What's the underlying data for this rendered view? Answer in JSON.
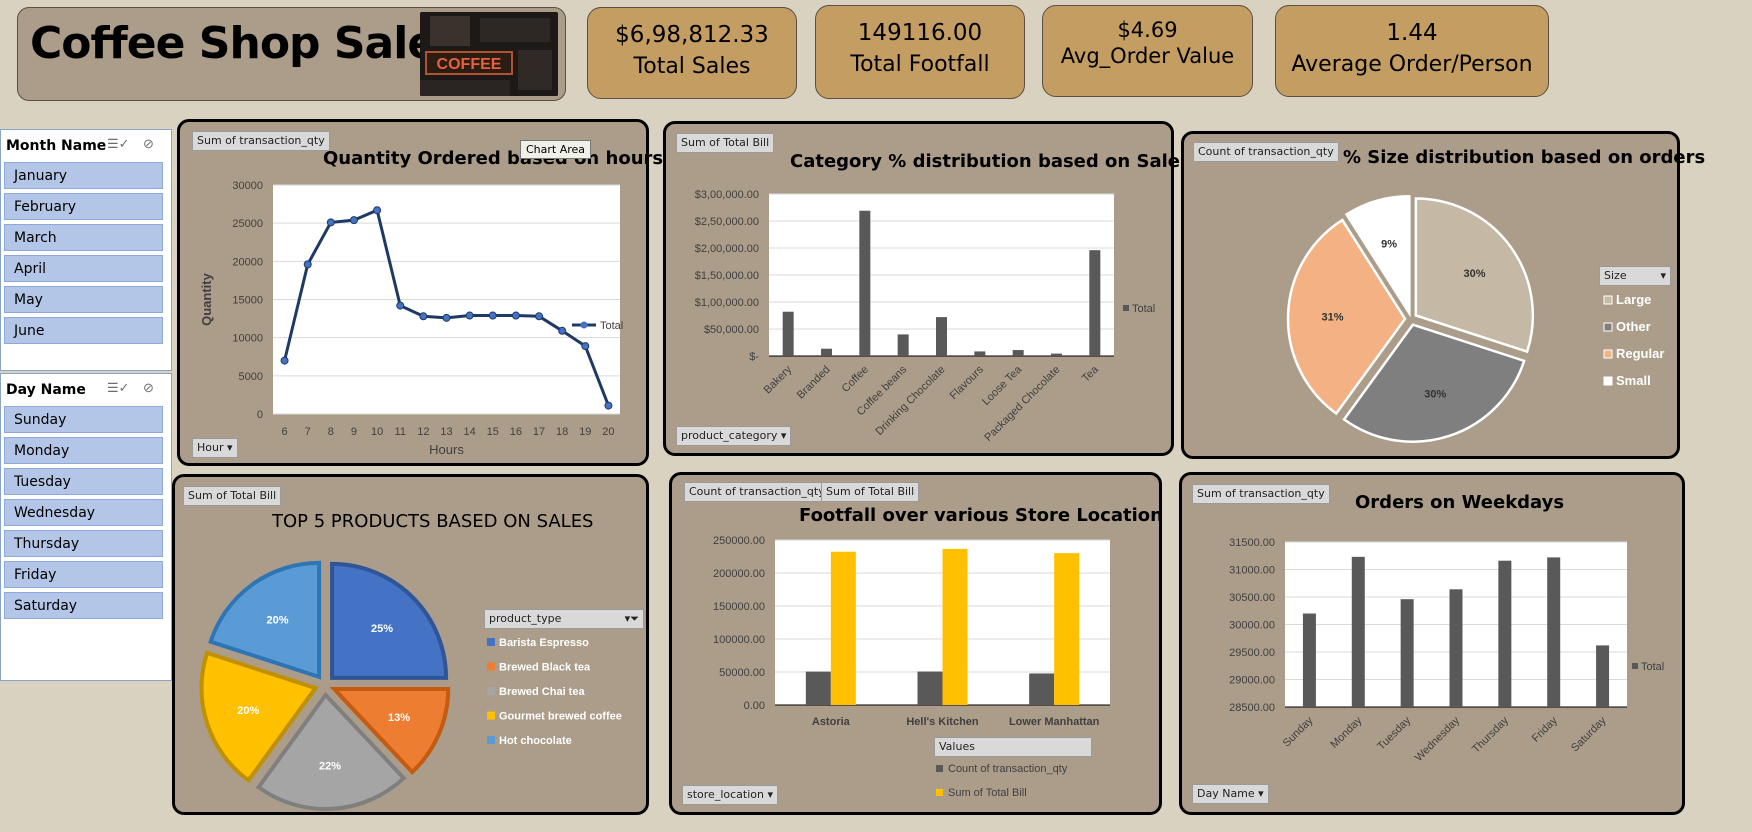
{
  "header": {
    "title": "Coffee Shop Sales",
    "logo_text": "COFFEE"
  },
  "kpis": [
    {
      "value": "$6,98,812.33",
      "label": "Total Sales"
    },
    {
      "value": "149116.00",
      "label": "Total Footfall"
    },
    {
      "value": "$4.69",
      "label": "Avg_Order Value"
    },
    {
      "value": "1.44",
      "label": "Average Order/Person"
    }
  ],
  "month_slicer": {
    "header": "Month Name",
    "items": [
      "January",
      "February",
      "March",
      "April",
      "May",
      "June"
    ]
  },
  "day_slicer": {
    "header": "Day Name",
    "items": [
      "Sunday",
      "Monday",
      "Tuesday",
      "Wednesday",
      "Thursday",
      "Friday",
      "Saturday"
    ]
  },
  "panels": {
    "hours": {
      "field_button": "Sum of transaction_qty",
      "axis_button": "Hour",
      "tooltip": "Chart Area"
    },
    "category": {
      "field_button": "Sum of Total Bill",
      "axis_button": "product_category"
    },
    "size": {
      "field_button": "Count of transaction_qty",
      "legend_button": "Size"
    },
    "products": {
      "field_button": "Sum of Total Bill",
      "legend_button": "product_type"
    },
    "footfall": {
      "field_button_1": "Count of transaction_qty",
      "field_button_2": "Sum of Total Bill",
      "axis_button": "store_location",
      "legend_button": "Values"
    },
    "weekdays": {
      "field_button": "Sum of transaction_qty",
      "axis_button": "Day Name"
    }
  },
  "colors": {
    "panel_bg": "#ab9d8a",
    "kpi_bg": "#c49d62",
    "bar_gray": "#595959",
    "line_navy": "#1f3864",
    "bar_gold": "#ffc000"
  },
  "chart_data": [
    {
      "id": "hours",
      "type": "line",
      "title": "Quantity Ordered based on hours",
      "xlabel": "Hours",
      "ylabel": "Quantity",
      "x": [
        6,
        7,
        8,
        9,
        10,
        11,
        12,
        13,
        14,
        15,
        16,
        17,
        18,
        19,
        20
      ],
      "series": [
        {
          "name": "Total",
          "values": [
            7000,
            19600,
            25100,
            25400,
            26700,
            14200,
            12800,
            12600,
            12900,
            12900,
            12900,
            12800,
            10900,
            8900,
            1100
          ]
        }
      ],
      "ylim": [
        0,
        30000
      ],
      "yticks": [
        "0",
        "5000",
        "10000",
        "15000",
        "20000",
        "25000",
        "30000"
      ],
      "grid": true,
      "legend": "right"
    },
    {
      "id": "category",
      "type": "bar",
      "title": "Category % distribution based on Sales",
      "categories": [
        "Bakery",
        "Branded",
        "Coffee",
        "Coffee beans",
        "Drinking Chocolate",
        "Flavours",
        "Loose Tea",
        "Packaged Chocolate",
        "Tea"
      ],
      "series": [
        {
          "name": "Total",
          "values": [
            82000,
            13500,
            269000,
            40000,
            72000,
            8500,
            11000,
            4400,
            196000
          ]
        }
      ],
      "ylim": [
        0,
        300000
      ],
      "yticks": [
        "$-",
        "$50,000.00",
        "$1,00,000.00",
        "$1,50,000.00",
        "$2,00,000.00",
        "$2,50,000.00",
        "$3,00,000.00"
      ],
      "grid": true,
      "legend": "right"
    },
    {
      "id": "size",
      "type": "pie",
      "title": "% Size distribution based on orders",
      "categories": [
        "Large",
        "Other",
        "Regular",
        "Small"
      ],
      "values": [
        30,
        30,
        31,
        9
      ],
      "labels": [
        "30%",
        "30%",
        "31%",
        "9%"
      ],
      "colors": [
        "#c5b8a5",
        "#7f7f7f",
        "#f4b183",
        "#ffffff"
      ],
      "legend": "right"
    },
    {
      "id": "products",
      "type": "pie",
      "title": "TOP 5 PRODUCTS BASED ON SALES",
      "categories": [
        "Barista Espresso",
        "Brewed Black tea",
        "Brewed Chai tea",
        "Gourmet brewed coffee",
        "Hot chocolate"
      ],
      "values": [
        25,
        13,
        22,
        20,
        20
      ],
      "labels": [
        "25%",
        "13%",
        "22%",
        "20%",
        "20%"
      ],
      "colors": [
        "#4472c4",
        "#ed7d31",
        "#a5a5a5",
        "#ffc000",
        "#5b9bd5"
      ],
      "legend": "right"
    },
    {
      "id": "footfall",
      "type": "bar",
      "title": "Footfall over various Store Location",
      "categories": [
        "Astoria",
        "Hell's Kitchen",
        "Lower Manhattan"
      ],
      "series": [
        {
          "name": "Count of transaction_qty",
          "values": [
            50599,
            50735,
            47782
          ]
        },
        {
          "name": "Sum of Total Bill",
          "values": [
            232243.91,
            236511.17,
            230057.25
          ]
        }
      ],
      "ylim": [
        0,
        250000
      ],
      "yticks": [
        "0.00",
        "50000.00",
        "100000.00",
        "150000.00",
        "200000.00",
        "250000.00"
      ],
      "grid": true,
      "legend": "bottom"
    },
    {
      "id": "weekdays",
      "type": "bar",
      "title": "Orders on Weekdays",
      "categories": [
        "Sunday",
        "Monday",
        "Tuesday",
        "Wednesday",
        "Thursday",
        "Friday",
        "Saturday"
      ],
      "series": [
        {
          "name": "Total",
          "values": [
            30200,
            31230,
            30460,
            30640,
            31160,
            31220,
            29620
          ]
        }
      ],
      "ylim": [
        28500,
        31500
      ],
      "yticks": [
        "28500.00",
        "29000.00",
        "29500.00",
        "30000.00",
        "30500.00",
        "31000.00",
        "31500.00"
      ],
      "grid": true,
      "legend": "right"
    }
  ]
}
